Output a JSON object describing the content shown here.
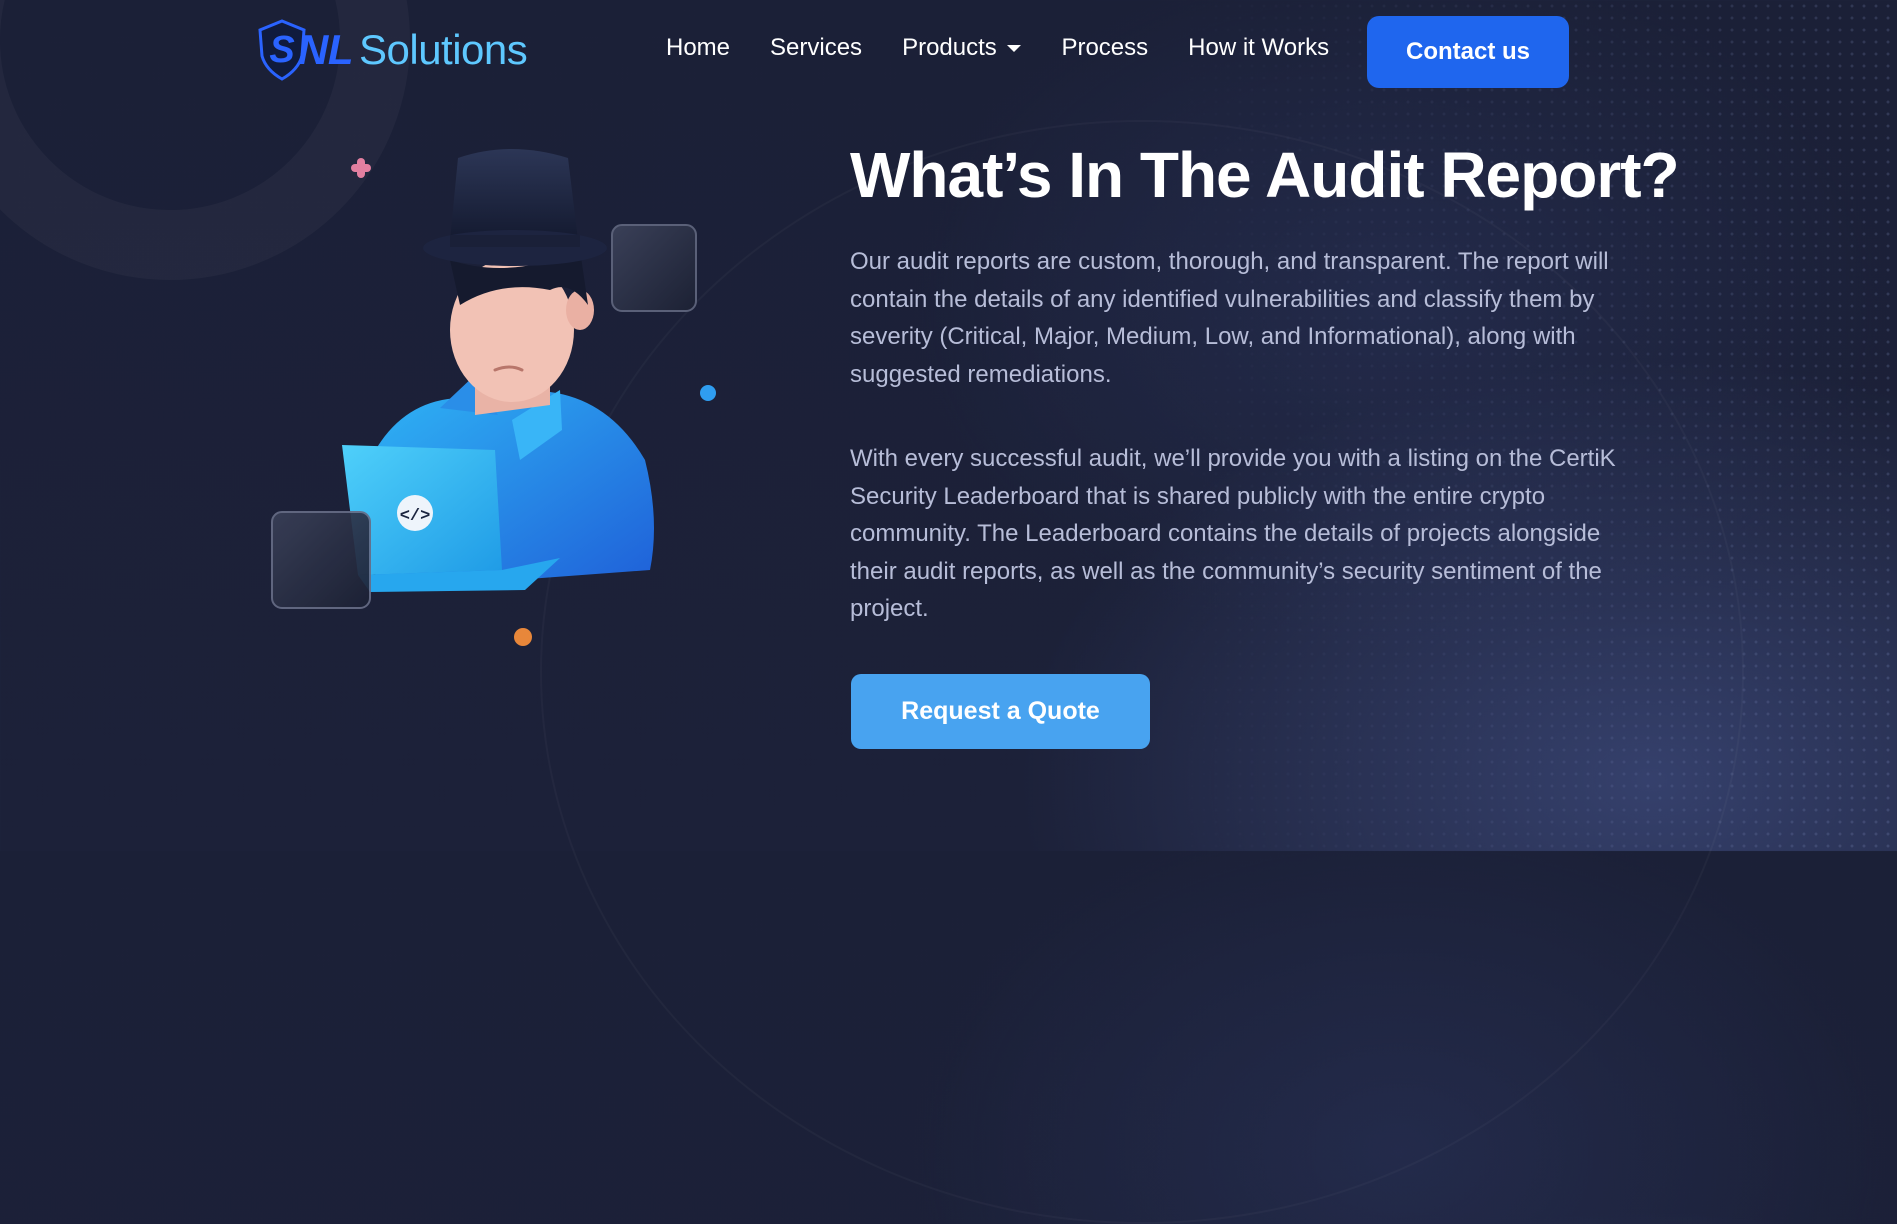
{
  "brand": {
    "logo_letter": "S",
    "name_part1": "NL",
    "name_part2": "Solutions",
    "colors": {
      "primary": "#2a63ff",
      "light": "#5ec8ff"
    }
  },
  "nav": {
    "items": [
      {
        "label": "Home"
      },
      {
        "label": "Services"
      },
      {
        "label": "Products",
        "has_dropdown": true
      },
      {
        "label": "Process"
      },
      {
        "label": "How it Works"
      }
    ],
    "contact_label": "Contact us"
  },
  "section": {
    "heading": "What’s In The Audit Report?",
    "paragraph1": "Our audit reports are custom, thorough, and transparent. The report will contain the details of any identified vulnerabilities and classify them by severity (Critical, Major, Medium, Low, and Informational), along with suggested remediations.",
    "paragraph2": "With every successful audit, we’ll provide you with a listing on the CertiK Security Leaderboard that is shared publicly with the entire crypto community. The Leaderboard contains the details of projects alongside their audit reports, as well as the community’s security sentiment of the project.",
    "cta_label": "Request a Quote"
  },
  "illustration": {
    "subject": "hacker-with-laptop",
    "laptop_icon": "code-icon"
  },
  "colors": {
    "background": "#1b2037",
    "contact_button": "#1f66ee",
    "quote_button": "#48a3f0",
    "body_text": "#b7bdd8"
  }
}
